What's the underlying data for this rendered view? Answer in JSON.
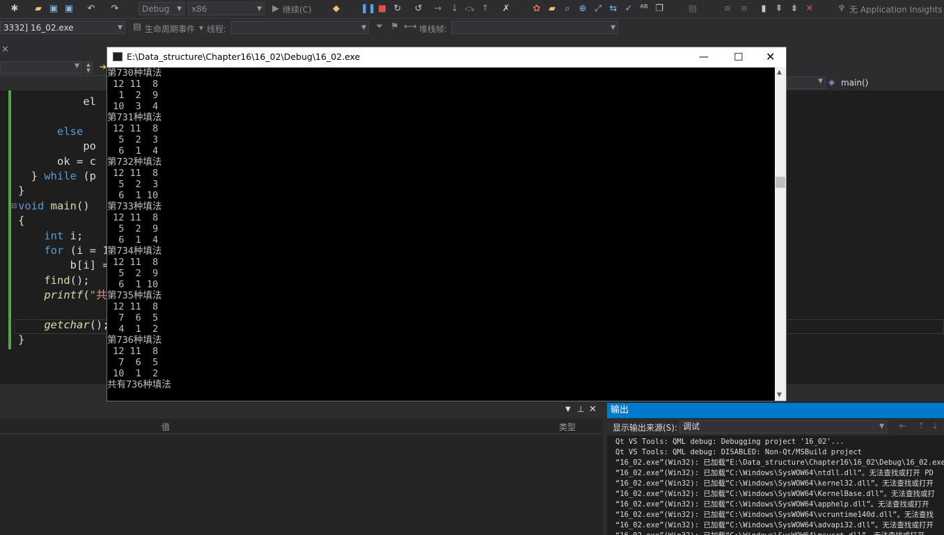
{
  "toolbar": {
    "config": "Debug",
    "platform": "x86",
    "continue_label": "继续(C)",
    "insights": "无 Application Insights"
  },
  "toolbar2": {
    "process": "3332] 16_02.exe",
    "lifecycle": "生命周期事件",
    "thread_label": "线程:",
    "stackframe_label": "堆栈帧:"
  },
  "navbar": {
    "function": "main()"
  },
  "editor": {
    "lines": [
      {
        "indent": "          ",
        "parts": [
          [
            "pl",
            "el"
          ]
        ]
      },
      {
        "indent": "",
        "parts": [
          [
            "pl",
            ""
          ]
        ]
      },
      {
        "indent": "      ",
        "parts": [
          [
            "kw",
            "else"
          ]
        ]
      },
      {
        "indent": "          ",
        "parts": [
          [
            "pl",
            "po"
          ]
        ]
      },
      {
        "indent": "      ",
        "parts": [
          [
            "pl",
            "ok = c"
          ]
        ]
      },
      {
        "indent": "  ",
        "parts": [
          [
            "pl",
            "} "
          ],
          [
            "kw",
            "while"
          ],
          [
            "pl",
            " (p"
          ]
        ]
      },
      {
        "indent": "",
        "parts": [
          [
            "pl",
            "}"
          ]
        ]
      },
      {
        "indent": "",
        "parts": [
          [
            "kw",
            "void"
          ],
          [
            "pl",
            " "
          ],
          [
            "fn",
            "main"
          ],
          [
            "pl",
            "()"
          ]
        ]
      },
      {
        "indent": "",
        "parts": [
          [
            "pl",
            "{"
          ]
        ]
      },
      {
        "indent": "    ",
        "parts": [
          [
            "kw",
            "int"
          ],
          [
            "pl",
            " i;"
          ]
        ]
      },
      {
        "indent": "    ",
        "parts": [
          [
            "kw",
            "for"
          ],
          [
            "pl",
            " (i = 1"
          ]
        ]
      },
      {
        "indent": "        ",
        "parts": [
          [
            "pl",
            "b[i] ="
          ]
        ]
      },
      {
        "indent": "    ",
        "parts": [
          [
            "fn",
            "find"
          ],
          [
            "pl",
            "();"
          ]
        ]
      },
      {
        "indent": "    ",
        "parts": [
          [
            "it",
            "printf"
          ],
          [
            "pl",
            "("
          ],
          [
            "st",
            "\"共"
          ]
        ]
      },
      {
        "indent": "",
        "parts": [
          [
            "pl",
            ""
          ]
        ]
      },
      {
        "indent": "    ",
        "parts": [
          [
            "it",
            "getchar"
          ],
          [
            "pl",
            "();"
          ]
        ]
      },
      {
        "indent": "",
        "parts": [
          [
            "pl",
            "}"
          ]
        ]
      }
    ]
  },
  "console": {
    "title": "E:\\Data_structure\\Chapter16\\16_02\\Debug\\16_02.exe",
    "lines": [
      "第730种填法",
      " 12 11  8",
      "  1  2  9",
      " 10  3  4",
      "第731种填法",
      " 12 11  8",
      "  5  2  3",
      "  6  1  4",
      "第732种填法",
      " 12 11  8",
      "  5  2  3",
      "  6  1 10",
      "第733种填法",
      " 12 11  8",
      "  5  2  9",
      "  6  1  4",
      "第734种填法",
      " 12 11  8",
      "  5  2  9",
      "  6  1 10",
      "第735种填法",
      " 12 11  8",
      "  7  6  5",
      "  4  1  2",
      "第736种填法",
      " 12 11  8",
      "  7  6  5",
      " 10  1  2",
      "共有736种填法"
    ]
  },
  "locals": {
    "col_value": "值",
    "col_type": "类型"
  },
  "output": {
    "title": "输出",
    "source_label": "显示输出来源(S):",
    "source_value": "调试",
    "lines": [
      "Qt VS Tools: QML debug: Debugging project '16_02'...",
      "Qt VS Tools: QML debug: DISABLED: Non-Qt/MSBuild project",
      "“16_02.exe”(Win32): 已加载“E:\\Data_structure\\Chapter16\\16_02\\Debug\\16_02.exe",
      "“16_02.exe”(Win32): 已加载“C:\\Windows\\SysWOW64\\ntdll.dll”。无法查找或打开 PD",
      "“16_02.exe”(Win32): 已加载“C:\\Windows\\SysWOW64\\kernel32.dll”。无法查找或打开",
      "“16_02.exe”(Win32): 已加载“C:\\Windows\\SysWOW64\\KernelBase.dll”。无法查找或打",
      "“16_02.exe”(Win32): 已加载“C:\\Windows\\SysWOW64\\apphelp.dll”。无法查找或打开",
      "“16_02.exe”(Win32): 已加载“C:\\Windows\\SysWOW64\\vcruntime140d.dll”。无法查找",
      "“16_02.exe”(Win32): 已加载“C:\\Windows\\SysWOW64\\advapi32.dll”。无法查找或打开",
      "“16_02.exe”(Win32): 已加载“C:\\Windows\\SysWOW64\\msvcrt.dll”。无法查找或打开"
    ]
  },
  "colors": {
    "accent": "#007acc",
    "editor_bg": "#1e1e1e",
    "chrome_bg": "#2d2d30",
    "keyword": "#569cd6",
    "function": "#dcdcaa",
    "string": "#d69d85"
  }
}
